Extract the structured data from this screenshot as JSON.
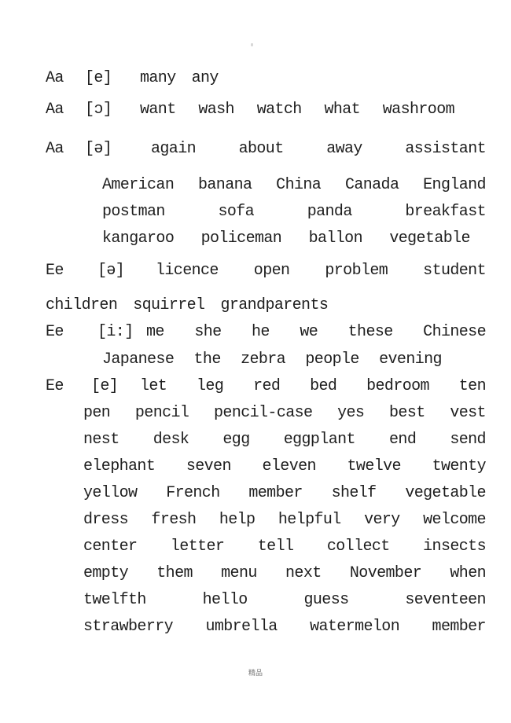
{
  "sections": [
    {
      "letter": "Aa",
      "sound": "[e]",
      "lines": [
        [
          "many",
          "any"
        ]
      ]
    },
    {
      "letter": "Aa",
      "sound": "[ɔ]",
      "lines": [
        [
          "want",
          "wash",
          "watch",
          "what",
          "washroom"
        ]
      ]
    },
    {
      "letter": "Aa",
      "sound": "[ə]",
      "lines": [
        [
          "again",
          "about",
          "away",
          "assistant"
        ],
        [
          "American",
          "banana",
          "China",
          "Canada",
          "England"
        ],
        [
          "postman",
          "sofa",
          "panda",
          "breakfast"
        ],
        [
          "kangaroo",
          "policeman",
          "ballon",
          "vegetable"
        ]
      ]
    },
    {
      "letter": "Ee",
      "sound": "[ə]",
      "lines": [
        [
          "licence",
          "open",
          "problem",
          "student"
        ],
        [
          "children",
          "squirrel",
          "grandparents"
        ]
      ]
    },
    {
      "letter": "Ee",
      "sound": "[i:]",
      "lines": [
        [
          "me",
          "she",
          "he",
          "we",
          "these",
          "Chinese"
        ],
        [
          "Japanese",
          "the",
          "zebra",
          "people",
          "evening"
        ]
      ]
    },
    {
      "letter": "Ee",
      "sound": "[e]",
      "lines": [
        [
          "let",
          "leg",
          "red",
          "bed",
          "bedroom",
          "ten"
        ],
        [
          "pen",
          "pencil",
          "pencil-case",
          "yes",
          "best",
          "vest"
        ],
        [
          "nest",
          "desk",
          "egg",
          "eggplant",
          "end",
          "send"
        ],
        [
          "elephant",
          "seven",
          "eleven",
          "twelve",
          "twenty"
        ],
        [
          "yellow",
          "French",
          "member",
          "shelf",
          "vegetable"
        ],
        [
          "dress",
          "fresh",
          "help",
          "helpful",
          "very",
          "welcome"
        ],
        [
          "center",
          "letter",
          "tell",
          "collect",
          "insects"
        ],
        [
          "empty",
          "them",
          "menu",
          "next",
          "November",
          "when"
        ],
        [
          "twelfth",
          "hello",
          "guess",
          "seventeen"
        ],
        [
          "strawberry",
          "umbrella",
          "watermelon",
          "member"
        ]
      ]
    }
  ],
  "footer": "精品"
}
